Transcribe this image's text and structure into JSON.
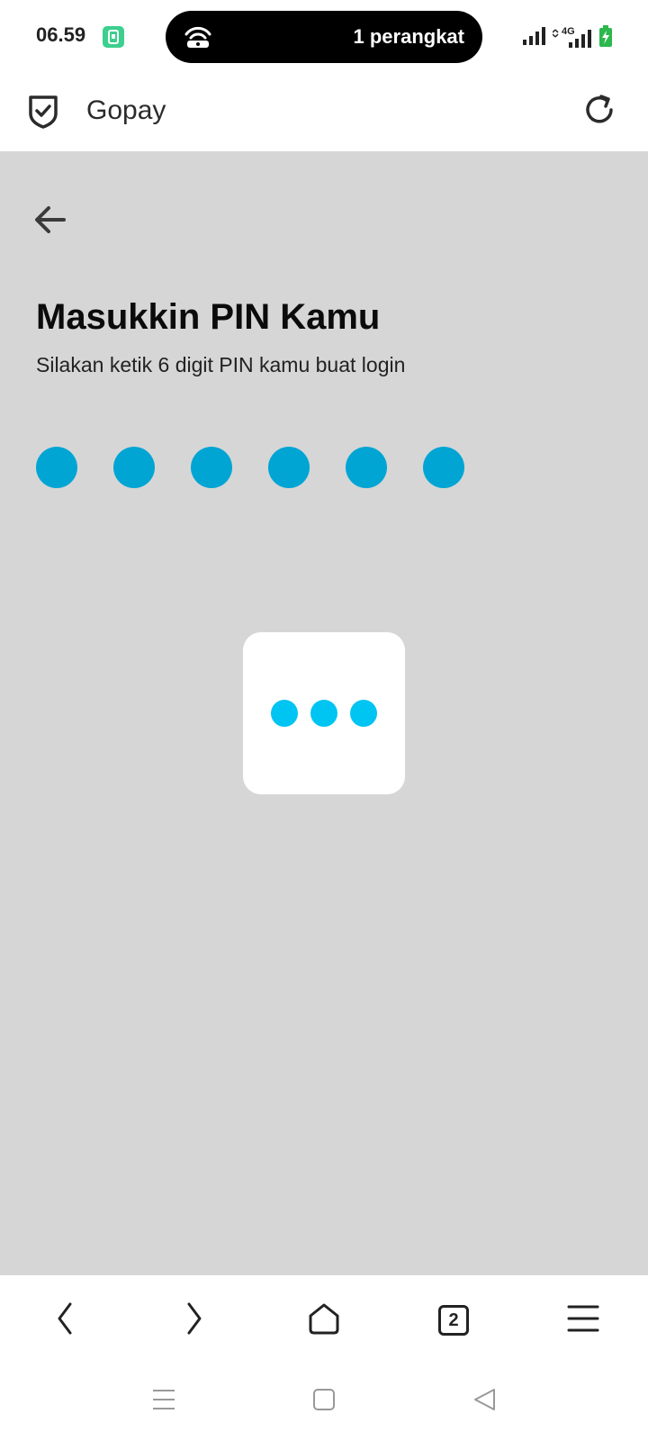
{
  "status_bar": {
    "time": "06.59",
    "hotspot_text": "1 perangkat",
    "network_label": "4G"
  },
  "app_bar": {
    "title": "Gopay"
  },
  "pin_screen": {
    "title": "Masukkin PIN Kamu",
    "subtitle": "Silakan ketik 6 digit PIN kamu buat login",
    "pin_length": 6,
    "filled_digits": 6
  },
  "browser_bar": {
    "tab_count": "2"
  },
  "colors": {
    "pin_dot": "#00a5d4",
    "loading_dot": "#00c4f2",
    "content_bg": "#d6d6d6"
  }
}
